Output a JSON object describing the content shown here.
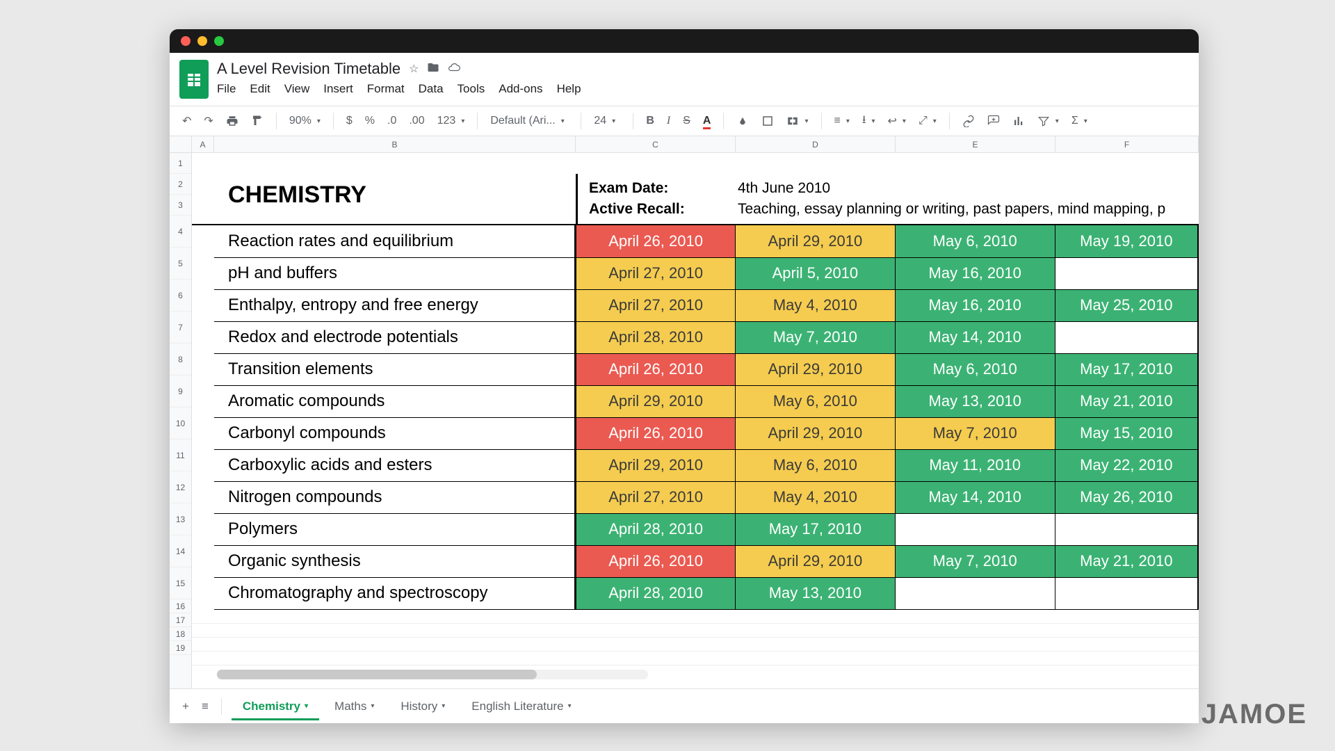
{
  "doc_title": "A Level Revision Timetable",
  "menus": [
    "File",
    "Edit",
    "View",
    "Insert",
    "Format",
    "Data",
    "Tools",
    "Add-ons",
    "Help"
  ],
  "toolbar": {
    "zoom": "90%",
    "currency": "$",
    "percent": "%",
    "dec_dec": ".0",
    "dec_inc": ".00",
    "num_format": "123",
    "font": "Default (Ari...",
    "font_size": "24"
  },
  "columns": [
    "A",
    "B",
    "C",
    "D",
    "E",
    "F"
  ],
  "row_numbers": [
    "1",
    "2",
    "3",
    "4",
    "5",
    "6",
    "7",
    "8",
    "9",
    "10",
    "11",
    "12",
    "13",
    "14",
    "15",
    "16",
    "17",
    "18",
    "19"
  ],
  "subject_title": "CHEMISTRY",
  "info": {
    "exam_date_label": "Exam Date:",
    "exam_date_value": "4th June 2010",
    "active_recall_label": "Active Recall:",
    "active_recall_value": "Teaching, essay planning or writing, past papers, mind mapping, p"
  },
  "colors": {
    "red": "#ea5a51",
    "yellow": "#f5cc4f",
    "green": "#3bb273"
  },
  "topics": [
    {
      "name": "Reaction rates and equilibrium",
      "dates": [
        {
          "text": "April 26, 2010",
          "c": "red"
        },
        {
          "text": "April 29, 2010",
          "c": "yellow"
        },
        {
          "text": "May 6, 2010",
          "c": "green"
        },
        {
          "text": "May 19, 2010",
          "c": "green"
        }
      ]
    },
    {
      "name": "pH and buffers",
      "dates": [
        {
          "text": "April 27, 2010",
          "c": "yellow"
        },
        {
          "text": "April 5, 2010",
          "c": "green"
        },
        {
          "text": "May 16, 2010",
          "c": "green"
        },
        {
          "text": "",
          "c": "empty"
        }
      ]
    },
    {
      "name": "Enthalpy, entropy and free energy",
      "dates": [
        {
          "text": "April 27, 2010",
          "c": "yellow"
        },
        {
          "text": "May 4, 2010",
          "c": "yellow"
        },
        {
          "text": "May 16, 2010",
          "c": "green"
        },
        {
          "text": "May 25, 2010",
          "c": "green"
        }
      ]
    },
    {
      "name": "Redox and electrode potentials",
      "dates": [
        {
          "text": "April 28, 2010",
          "c": "yellow"
        },
        {
          "text": "May 7, 2010",
          "c": "green"
        },
        {
          "text": "May 14, 2010",
          "c": "green"
        },
        {
          "text": "",
          "c": "empty"
        }
      ]
    },
    {
      "name": "Transition elements",
      "dates": [
        {
          "text": "April 26, 2010",
          "c": "red"
        },
        {
          "text": "April 29, 2010",
          "c": "yellow"
        },
        {
          "text": "May 6, 2010",
          "c": "green"
        },
        {
          "text": "May 17, 2010",
          "c": "green"
        }
      ]
    },
    {
      "name": "Aromatic compounds",
      "dates": [
        {
          "text": "April 29, 2010",
          "c": "yellow"
        },
        {
          "text": "May 6, 2010",
          "c": "yellow"
        },
        {
          "text": "May 13, 2010",
          "c": "green"
        },
        {
          "text": "May 21, 2010",
          "c": "green"
        }
      ]
    },
    {
      "name": "Carbonyl compounds",
      "dates": [
        {
          "text": "April 26, 2010",
          "c": "red"
        },
        {
          "text": "April 29, 2010",
          "c": "yellow"
        },
        {
          "text": "May 7, 2010",
          "c": "yellow"
        },
        {
          "text": "May 15, 2010",
          "c": "green"
        }
      ]
    },
    {
      "name": "Carboxylic acids and esters",
      "dates": [
        {
          "text": "April 29, 2010",
          "c": "yellow"
        },
        {
          "text": "May 6, 2010",
          "c": "yellow"
        },
        {
          "text": "May 11, 2010",
          "c": "green"
        },
        {
          "text": "May 22, 2010",
          "c": "green"
        }
      ]
    },
    {
      "name": "Nitrogen compounds",
      "dates": [
        {
          "text": "April 27, 2010",
          "c": "yellow"
        },
        {
          "text": "May 4, 2010",
          "c": "yellow"
        },
        {
          "text": "May 14, 2010",
          "c": "green"
        },
        {
          "text": "May 26, 2010",
          "c": "green"
        }
      ]
    },
    {
      "name": "Polymers",
      "dates": [
        {
          "text": "April 28, 2010",
          "c": "green"
        },
        {
          "text": "May 17, 2010",
          "c": "green"
        },
        {
          "text": "",
          "c": "empty"
        },
        {
          "text": "",
          "c": "empty"
        }
      ]
    },
    {
      "name": "Organic synthesis",
      "dates": [
        {
          "text": "April 26, 2010",
          "c": "red"
        },
        {
          "text": "April 29, 2010",
          "c": "yellow"
        },
        {
          "text": "May 7, 2010",
          "c": "green"
        },
        {
          "text": "May 21, 2010",
          "c": "green"
        }
      ]
    },
    {
      "name": "Chromatography and spectroscopy",
      "dates": [
        {
          "text": "April 28, 2010",
          "c": "green"
        },
        {
          "text": "May 13, 2010",
          "c": "green"
        },
        {
          "text": "",
          "c": "empty"
        },
        {
          "text": "",
          "c": "empty"
        }
      ]
    }
  ],
  "tabs": [
    {
      "label": "Chemistry",
      "active": true
    },
    {
      "label": "Maths",
      "active": false
    },
    {
      "label": "History",
      "active": false
    },
    {
      "label": "English Literature",
      "active": false
    }
  ],
  "watermark": "JAMOE"
}
